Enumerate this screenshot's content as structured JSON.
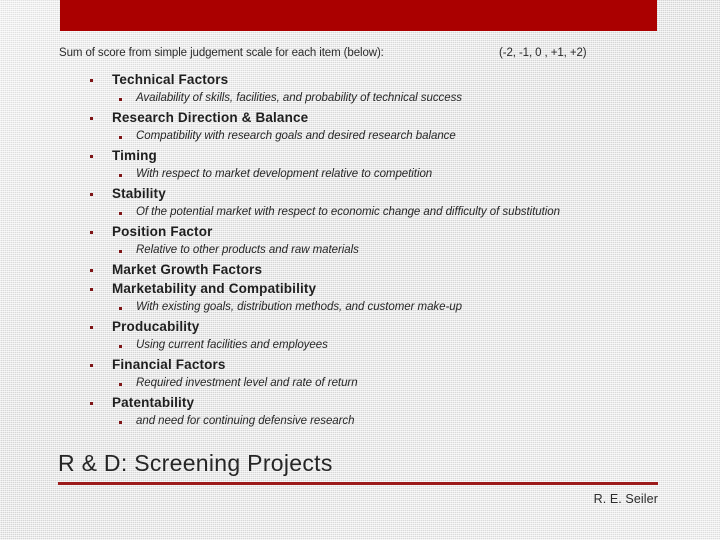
{
  "slide": {
    "header_bar_color": "#aa0000",
    "accent_rule_color": "#9c1b1b",
    "bullet_color": "#7e1416",
    "background_color": "#e9e9e9",
    "intro": {
      "label": "Sum of score from simple judgement scale for each item (below):",
      "scale": "(-2, -1, 0 , +1, +2)"
    },
    "outline": [
      {
        "level": 1,
        "text": "Technical Factors"
      },
      {
        "level": 2,
        "text": "Availability of skills, facilities, and probability of technical success"
      },
      {
        "level": 1,
        "text": "Research Direction & Balance"
      },
      {
        "level": 2,
        "text": "Compatibility with research goals and desired research balance"
      },
      {
        "level": 1,
        "text": "Timing"
      },
      {
        "level": 2,
        "text": "With respect to market development relative to competition"
      },
      {
        "level": 1,
        "text": "Stability"
      },
      {
        "level": 2,
        "text": "Of the potential market with respect to economic change and difficulty of substitution"
      },
      {
        "level": 1,
        "text": "Position Factor"
      },
      {
        "level": 2,
        "text": "Relative to other products and raw materials"
      },
      {
        "level": 1,
        "text": "Market Growth Factors"
      },
      {
        "level": 1,
        "text": "Marketability and Compatibility"
      },
      {
        "level": 2,
        "text": "With existing goals, distribution methods, and customer make-up"
      },
      {
        "level": 1,
        "text": "Producability"
      },
      {
        "level": 2,
        "text": "Using current facilities and employees"
      },
      {
        "level": 1,
        "text": "Financial Factors"
      },
      {
        "level": 2,
        "text": "Required investment level and rate of return"
      },
      {
        "level": 1,
        "text": "Patentability"
      },
      {
        "level": 2,
        "text": "and need for continuing defensive research"
      }
    ],
    "title": "R & D:  Screening Projects",
    "author": "R. E. Seiler"
  }
}
